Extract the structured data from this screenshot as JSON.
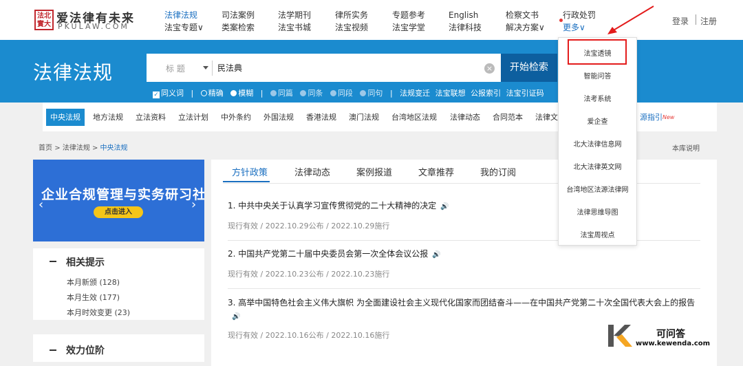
{
  "header": {
    "seal_text": "法北\n實大",
    "logo_cn": "爱法律有未来",
    "logo_en": "PKULAW.COM",
    "nav": [
      {
        "top": "法律法规",
        "bottom": "法宝专题∨"
      },
      {
        "top": "司法案例",
        "bottom": "类案检索"
      },
      {
        "top": "法学期刊",
        "bottom": "法宝书城"
      },
      {
        "top": "律所实务",
        "bottom": "法宝视频"
      },
      {
        "top": "专题参考",
        "bottom": "法宝学堂"
      },
      {
        "top": "English",
        "bottom": "法律科技"
      },
      {
        "top": "检察文书",
        "bottom": "解决方案∨"
      },
      {
        "top": "行政处罚",
        "bottom": "更多∨"
      }
    ],
    "login": "登录",
    "register": "注册"
  },
  "hero": {
    "title": "法律法规",
    "search_type": "标 题",
    "search_value": "民法典",
    "search_button": "开始检索",
    "options": {
      "synonym": "同义词",
      "precise": "精确",
      "fuzzy": "模糊",
      "same_article": "同篇",
      "same_clause": "同条",
      "same_para": "同段",
      "same_sentence": "同句",
      "links": [
        "法规变迁",
        "法宝联想",
        "公报索引",
        "法宝引证码"
      ]
    }
  },
  "categories": [
    "中央法规",
    "地方法规",
    "立法资料",
    "立法计划",
    "中外条约",
    "外国法规",
    "香港法规",
    "澳门法规",
    "台湾地区法规",
    "法律动态",
    "合同范本",
    "法律文"
  ],
  "category_tail": "源指引",
  "category_new": "New",
  "breadcrumb": {
    "home": "首页",
    "sep": ">",
    "lvl1": "法律法规",
    "current": "中央法规"
  },
  "library_note": "本库说明",
  "banner": {
    "title": "企业合规管理与实务研习社",
    "button": "点击进入",
    "prev": "‹",
    "next": "›"
  },
  "related": {
    "title": "相关提示",
    "items": [
      "本月新颁 (128)",
      "本月生效 (177)",
      "本月时效变更 (23)"
    ]
  },
  "effect_level": {
    "title": "效力位阶"
  },
  "tabs": [
    "方针政策",
    "法律动态",
    "案例报道",
    "文章推荐",
    "我的订阅"
  ],
  "articles": [
    {
      "title": "1. 中共中央关于认真学习宣传贯彻党的二十大精神的决定",
      "meta": "现行有效 / 2022.10.29公布 / 2022.10.29施行"
    },
    {
      "title": "2. 中国共产党第二十届中央委员会第一次全体会议公报",
      "meta": "现行有效 / 2022.10.23公布 / 2022.10.23施行"
    },
    {
      "title": "3. 高举中国特色社会主义伟大旗帜 为全面建设社会主义现代化国家而团结奋斗——在中国共产党第二十次全国代表大会上的报告",
      "meta": "现行有效 / 2022.10.16公布 / 2022.10.16施行"
    }
  ],
  "more_menu": [
    "法宝透镜",
    "智能问答",
    "法考系统",
    "爱企查",
    "北大法律信息网",
    "北大法律英文网",
    "台湾地区法源法律网",
    "法律思维导图",
    "法宝周视点"
  ],
  "watermark": {
    "title": "可问答",
    "url": "www.kewenda.com",
    "letter": "K"
  },
  "colors": {
    "brand_blue": "#1b8bcf",
    "button_dark": "#0d5f9f",
    "highlight_red": "#e31b1b"
  }
}
